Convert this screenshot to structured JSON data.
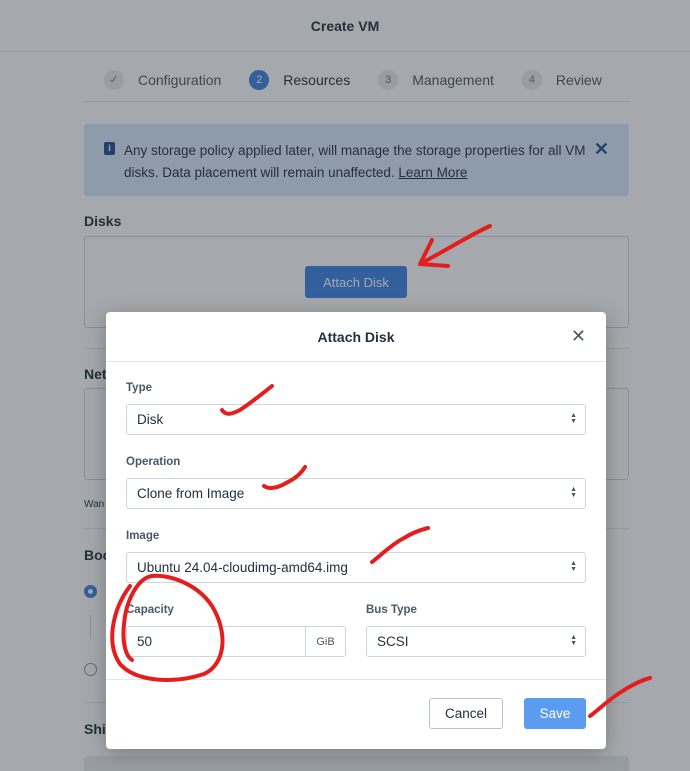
{
  "header": {
    "title": "Create VM"
  },
  "steps": [
    {
      "num": "✓",
      "label": "Configuration"
    },
    {
      "num": "2",
      "label": "Resources"
    },
    {
      "num": "3",
      "label": "Management"
    },
    {
      "num": "4",
      "label": "Review"
    }
  ],
  "banner": {
    "text": "Any storage policy applied later, will manage the storage properties for all VM disks. Data placement will remain unaffected.",
    "link": "Learn More"
  },
  "sections": {
    "disks": "Disks",
    "attach_disk_button": "Attach Disk",
    "networks_partial": "Net",
    "want_partial": "Wan",
    "boot_partial": "Boo",
    "shield_partial": "Shie"
  },
  "modal": {
    "title": "Attach Disk",
    "type_label": "Type",
    "type_value": "Disk",
    "operation_label": "Operation",
    "operation_value": "Clone from Image",
    "image_label": "Image",
    "image_value": "Ubuntu 24.04-cloudimg-amd64.img",
    "capacity_label": "Capacity",
    "capacity_value": "50",
    "capacity_unit": "GiB",
    "bus_type_label": "Bus Type",
    "bus_type_value": "SCSI",
    "cancel_label": "Cancel",
    "save_label": "Save"
  },
  "colors": {
    "primary": "#3b82e6",
    "save_button": "#5b9cf0",
    "banner_bg": "#d8e8fb",
    "annotation_red": "#e41e1e"
  }
}
